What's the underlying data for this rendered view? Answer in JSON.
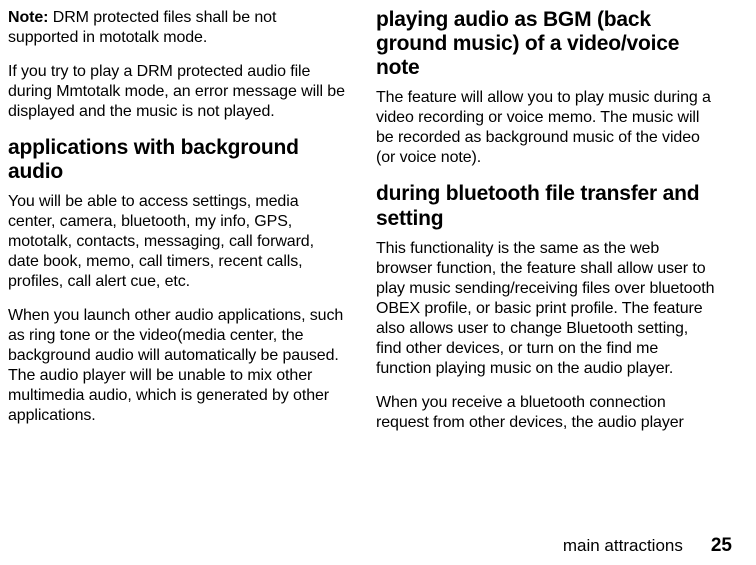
{
  "left": {
    "note_label": "Note:",
    "note_body": " DRM protected files shall be not supported in mototalk mode.",
    "drm_para": "If you try to play a DRM protected audio file during Mmtotalk mode, an error message will be displayed and the music is not played.",
    "heading_apps": "applications with background audio",
    "apps_para1": "You will be able to access settings, media center, camera, bluetooth, my info, GPS, mototalk, contacts, messaging, call forward, date book, memo, call timers, recent calls, profiles, call alert cue, etc.",
    "apps_para2": "When you launch other audio applications, such as ring tone or the video(media center, the background audio will automatically be paused. The audio player will be unable to mix other multimedia audio, which is generated by other applications."
  },
  "right": {
    "heading_bgm": "playing audio as BGM (back ground music) of a video/voice note",
    "bgm_para": "The feature will allow you to play music during a video recording or voice memo. The music will be recorded as background music of the video (or voice note).",
    "heading_bt": "during bluetooth file transfer and setting",
    "bt_para1": "This functionality is the same as the web browser function, the feature shall allow user to play music sending/receiving files over bluetooth OBEX profile, or basic print profile. The feature also allows user to change Bluetooth setting, find other devices, or turn on the find me function playing music on the audio player.",
    "bt_para2": "When you receive a bluetooth connection request from other devices, the audio player"
  },
  "footer": {
    "section": "main attractions",
    "page": "25"
  }
}
